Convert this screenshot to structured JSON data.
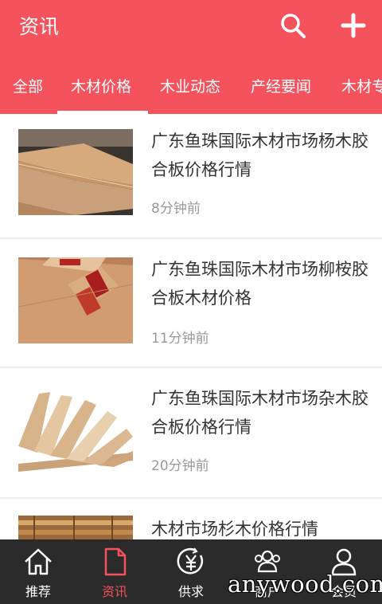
{
  "header": {
    "title": "资讯"
  },
  "tabs": [
    {
      "label": "全部"
    },
    {
      "label": "木材价格",
      "active": true
    },
    {
      "label": "木业动态"
    },
    {
      "label": "产经要闻"
    },
    {
      "label": "木材专"
    }
  ],
  "articles": [
    {
      "title": "广东鱼珠国际木材市场杨木胶合板价格行情",
      "time": "8分钟前"
    },
    {
      "title": "广东鱼珠国际木材市场柳桉胶合板木材价格",
      "time": "11分钟前"
    },
    {
      "title": "广东鱼珠国际木材市场杂木胶合板价格行情",
      "time": "20分钟前"
    },
    {
      "title": "木材市场杉木价格行情",
      "time": ""
    }
  ],
  "bottom_nav": [
    {
      "label": "推荐",
      "icon": "home-icon"
    },
    {
      "label": "资讯",
      "icon": "document-icon",
      "active": true
    },
    {
      "label": "供求",
      "icon": "yen-icon"
    },
    {
      "label": "商户",
      "icon": "people-icon"
    },
    {
      "label": "会员",
      "icon": "user-icon"
    }
  ],
  "watermark": "anywood.com",
  "colors": {
    "accent": "#f4525c",
    "nav_bg": "#2b2b2b"
  }
}
